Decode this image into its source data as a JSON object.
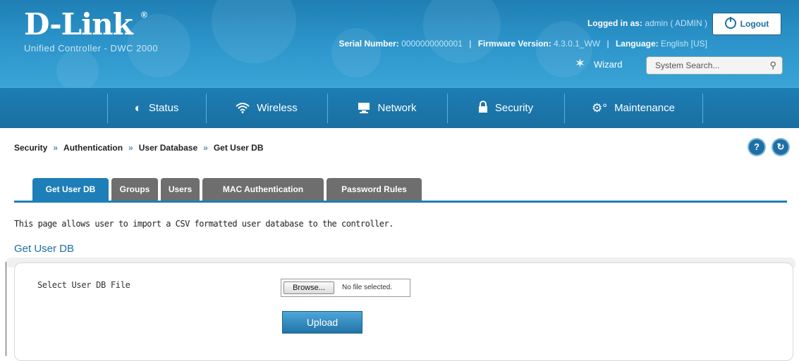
{
  "header": {
    "logo": "D-Link",
    "logo_mark": "®",
    "subtitle": "Unified Controller - DWC 2000",
    "logged_in_label": "Logged in as:",
    "logged_in_value": "admin ( ADMIN )",
    "logout_label": "Logout",
    "serial_label": "Serial Number:",
    "serial_value": "0000000000001",
    "firmware_label": "Firmware Version:",
    "firmware_value": "4.3.0.1_WW",
    "language_label": "Language:",
    "language_value": "English [US]",
    "wizard_label": "Wizard",
    "search_placeholder": "System Search..."
  },
  "nav": {
    "items": [
      {
        "label": "Status",
        "icon": "gauge-icon"
      },
      {
        "label": "Wireless",
        "icon": "wifi-icon"
      },
      {
        "label": "Network",
        "icon": "monitor-icon"
      },
      {
        "label": "Security",
        "icon": "lock-icon"
      },
      {
        "label": "Maintenance",
        "icon": "gears-icon"
      }
    ],
    "active": "Security"
  },
  "breadcrumb": {
    "items": [
      "Security",
      "Authentication",
      "User Database",
      "Get User DB"
    ],
    "separator": "»"
  },
  "tabs": {
    "items": [
      "Get User DB",
      "Groups",
      "Users",
      "MAC Authentication",
      "Password Rules"
    ],
    "active": "Get User DB"
  },
  "page": {
    "description": "This page allows user to import a CSV formatted user database to the controller.",
    "section_title": "Get User DB",
    "field_label": "Select User DB File",
    "browse_label": "Browse...",
    "file_status": "No file selected.",
    "upload_label": "Upload"
  },
  "colors": {
    "brand_blue": "#1e7fb8",
    "tab_inactive": "#6e6e6e"
  }
}
